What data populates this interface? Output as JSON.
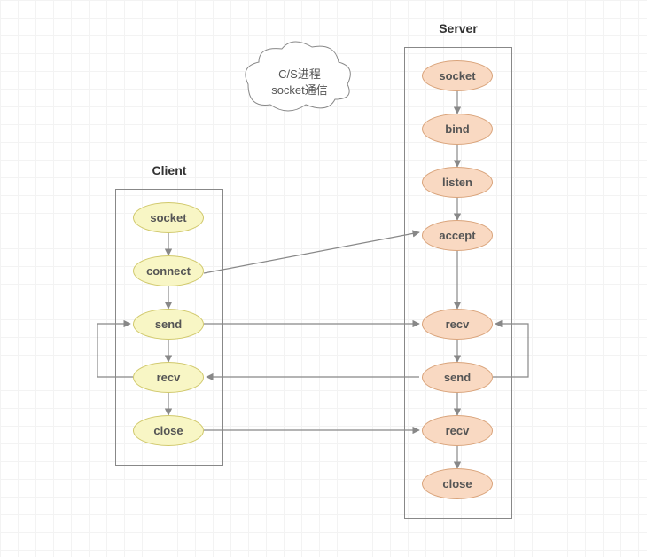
{
  "title_client": "Client",
  "title_server": "Server",
  "cloud": {
    "line1": "C/S进程",
    "line2": "socket通信"
  },
  "client": {
    "nodes": [
      "socket",
      "connect",
      "send",
      "recv",
      "close"
    ]
  },
  "server": {
    "nodes": [
      "socket",
      "bind",
      "listen",
      "accept",
      "recv",
      "send",
      "recv",
      "close"
    ]
  },
  "chart_data": {
    "type": "flow-diagram",
    "description": "C/S socket communication flow",
    "columns": [
      {
        "name": "Client",
        "steps": [
          "socket",
          "connect",
          "send",
          "recv",
          "close"
        ]
      },
      {
        "name": "Server",
        "steps": [
          "socket",
          "bind",
          "listen",
          "accept",
          "recv",
          "send",
          "recv",
          "close"
        ]
      }
    ],
    "internal_edges": [
      [
        "Client:socket",
        "Client:connect"
      ],
      [
        "Client:connect",
        "Client:send"
      ],
      [
        "Client:send",
        "Client:recv"
      ],
      [
        "Client:recv",
        "Client:close"
      ],
      [
        "Server:socket",
        "Server:bind"
      ],
      [
        "Server:bind",
        "Server:listen"
      ],
      [
        "Server:listen",
        "Server:accept"
      ],
      [
        "Server:accept",
        "Server:recv"
      ],
      [
        "Server:recv",
        "Server:send"
      ],
      [
        "Server:send",
        "Server:recv2"
      ],
      [
        "Server:recv2",
        "Server:close"
      ]
    ],
    "cross_edges": [
      [
        "Client:connect",
        "Server:accept"
      ],
      [
        "Client:send",
        "Server:recv"
      ],
      [
        "Server:send",
        "Client:recv"
      ],
      [
        "Client:close",
        "Server:recv2"
      ]
    ],
    "loops": [
      [
        "Client:send",
        "Client:recv"
      ],
      [
        "Server:recv",
        "Server:send"
      ]
    ]
  }
}
